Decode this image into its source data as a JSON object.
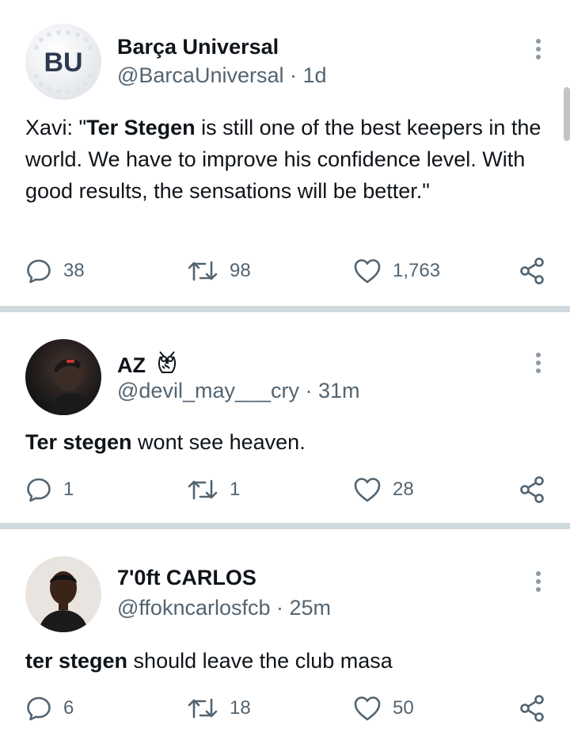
{
  "tweets": [
    {
      "avatar_text": "BU",
      "name": "Barça Universal",
      "handle": "@BarcaUniversal",
      "time": "1d",
      "text_prefix": "Xavi: \"",
      "text_bold": "Ter Stegen",
      "text_suffix": " is still one of the best keepers in the world. We have to improve his confidence level. With good results, the sensations will be better.\"",
      "replies": "38",
      "retweets": "98",
      "likes": "1,763"
    },
    {
      "name": "AZ",
      "name_emoji": "owl-emoji",
      "handle": "@devil_may___cry",
      "time": "31m",
      "text_prefix": "",
      "text_bold": "Ter stegen",
      "text_suffix": " wont see heaven.",
      "replies": "1",
      "retweets": "1",
      "likes": "28"
    },
    {
      "name": "7'0ft CARLOS",
      "handle": "@ffokncarlosfcb",
      "time": "25m",
      "text_prefix": "",
      "text_bold": "ter stegen",
      "text_suffix": " should leave the club masa",
      "replies": "6",
      "retweets": "18",
      "likes": "50"
    }
  ],
  "separator": " · ",
  "colors": {
    "text": "#0f1419",
    "secondary": "#536471",
    "divider": "#cfd9de"
  },
  "icons": [
    "reply-icon",
    "retweet-icon",
    "like-icon",
    "share-icon",
    "more-options-icon"
  ]
}
